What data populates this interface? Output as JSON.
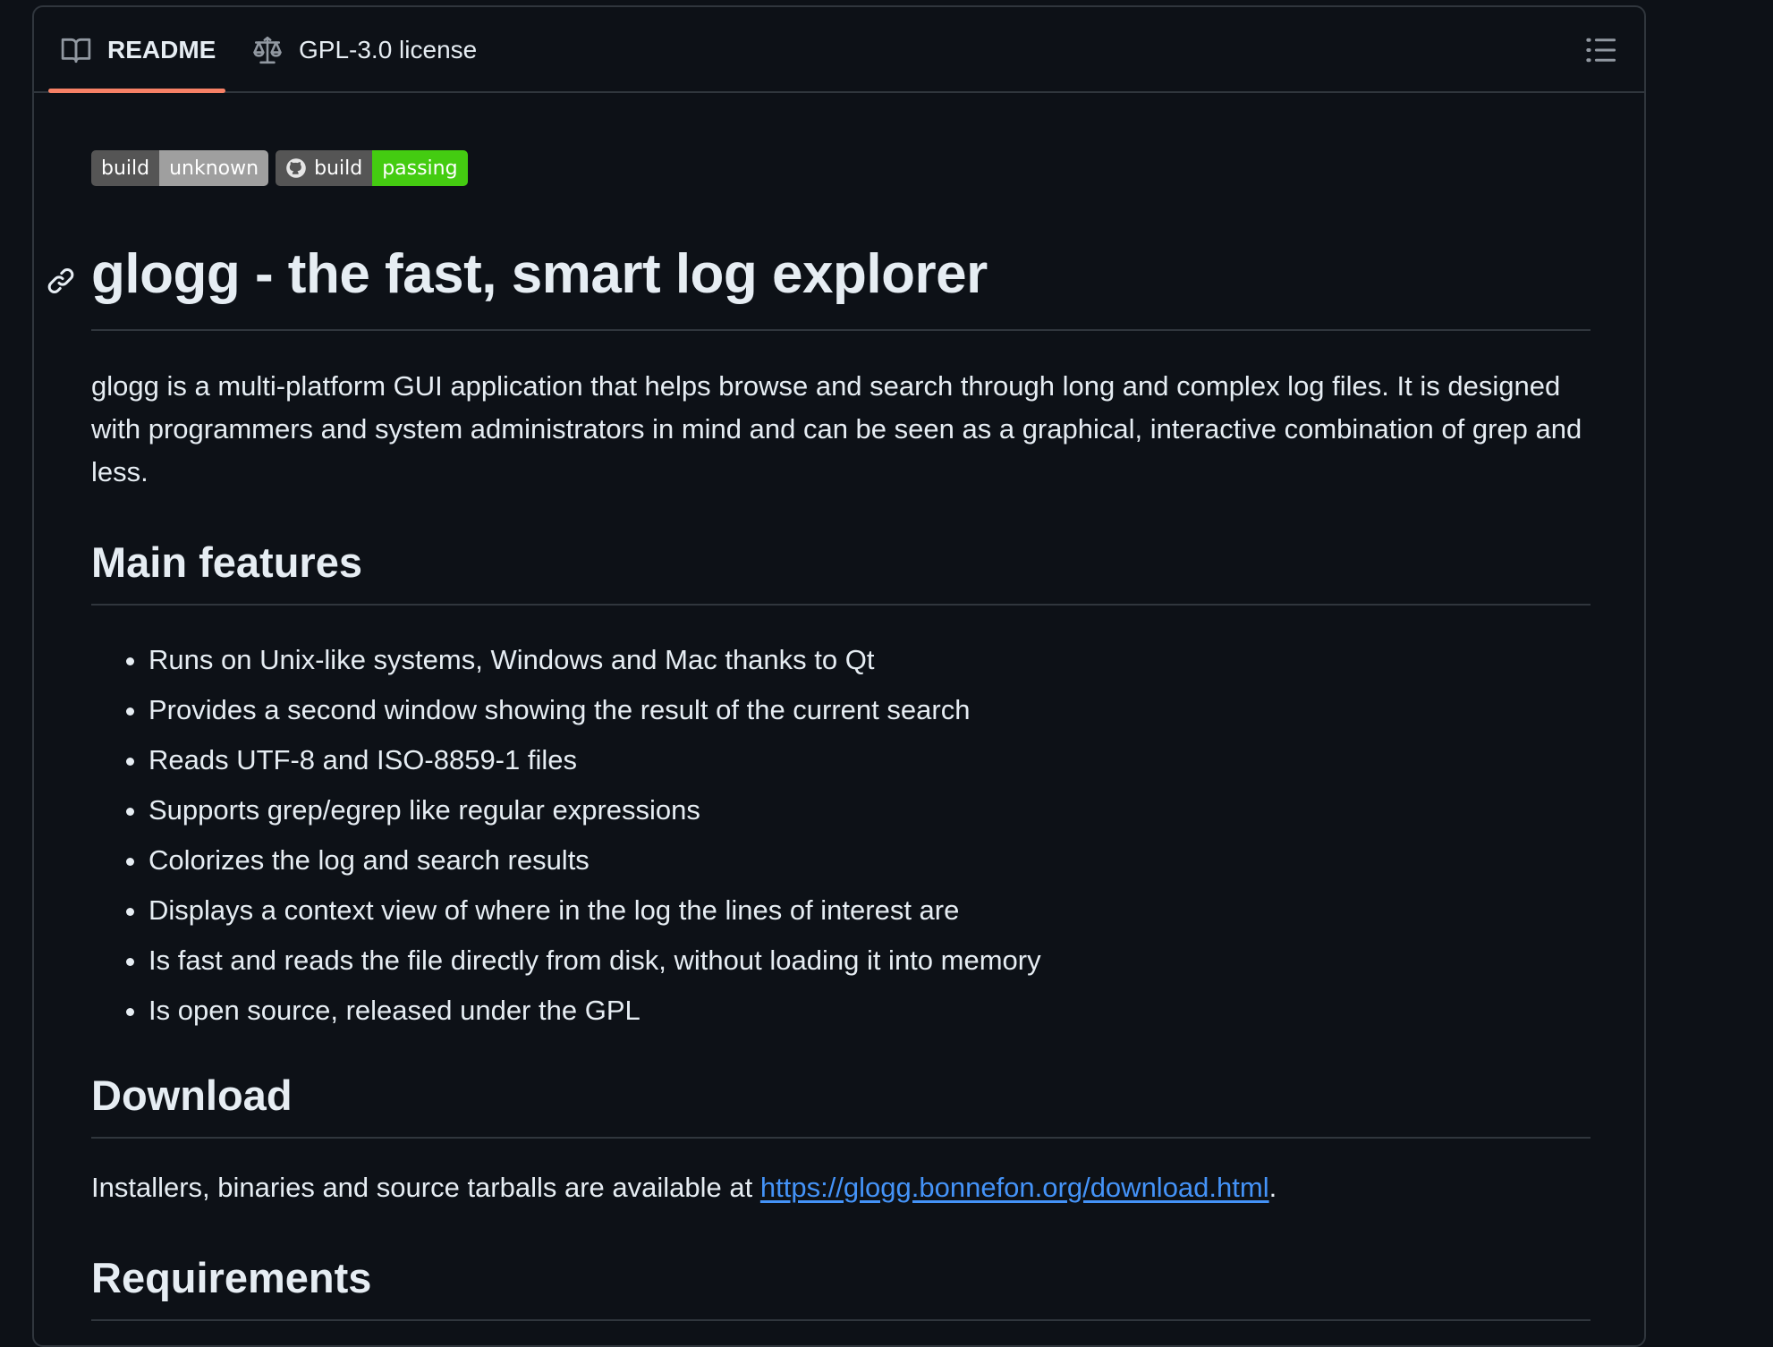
{
  "tabs": {
    "readme_label": "README",
    "license_label": "GPL-3.0 license"
  },
  "badges": [
    {
      "left": "build",
      "right": "unknown",
      "right_color": "#9f9f9f"
    },
    {
      "left": "build",
      "right": "passing",
      "right_color": "#44cc11"
    }
  ],
  "readme": {
    "title": "glogg - the fast, smart log explorer",
    "intro": "glogg is a multi-platform GUI application that helps browse and search through long and complex log files. It is designed with programmers and system administrators in mind and can be seen as a graphical, interactive combination of grep and less.",
    "features_heading": "Main features",
    "features": [
      "Runs on Unix-like systems, Windows and Mac thanks to Qt",
      "Provides a second window showing the result of the current search",
      "Reads UTF-8 and ISO-8859-1 files",
      "Supports grep/egrep like regular expressions",
      "Colorizes the log and search results",
      "Displays a context view of where in the log the lines of interest are",
      "Is fast and reads the file directly from disk, without loading it into memory",
      "Is open source, released under the GPL"
    ],
    "download_heading": "Download",
    "download_text": "Installers, binaries and source tarballs are available at ",
    "download_link": "https://glogg.bonnefon.org/download.html",
    "download_suffix": ".",
    "requirements_heading": "Requirements"
  },
  "colors": {
    "background": "#0d1117",
    "border": "#30363d",
    "text": "#e6edf3",
    "link": "#4493f8",
    "tab_accent": "#f78166"
  }
}
